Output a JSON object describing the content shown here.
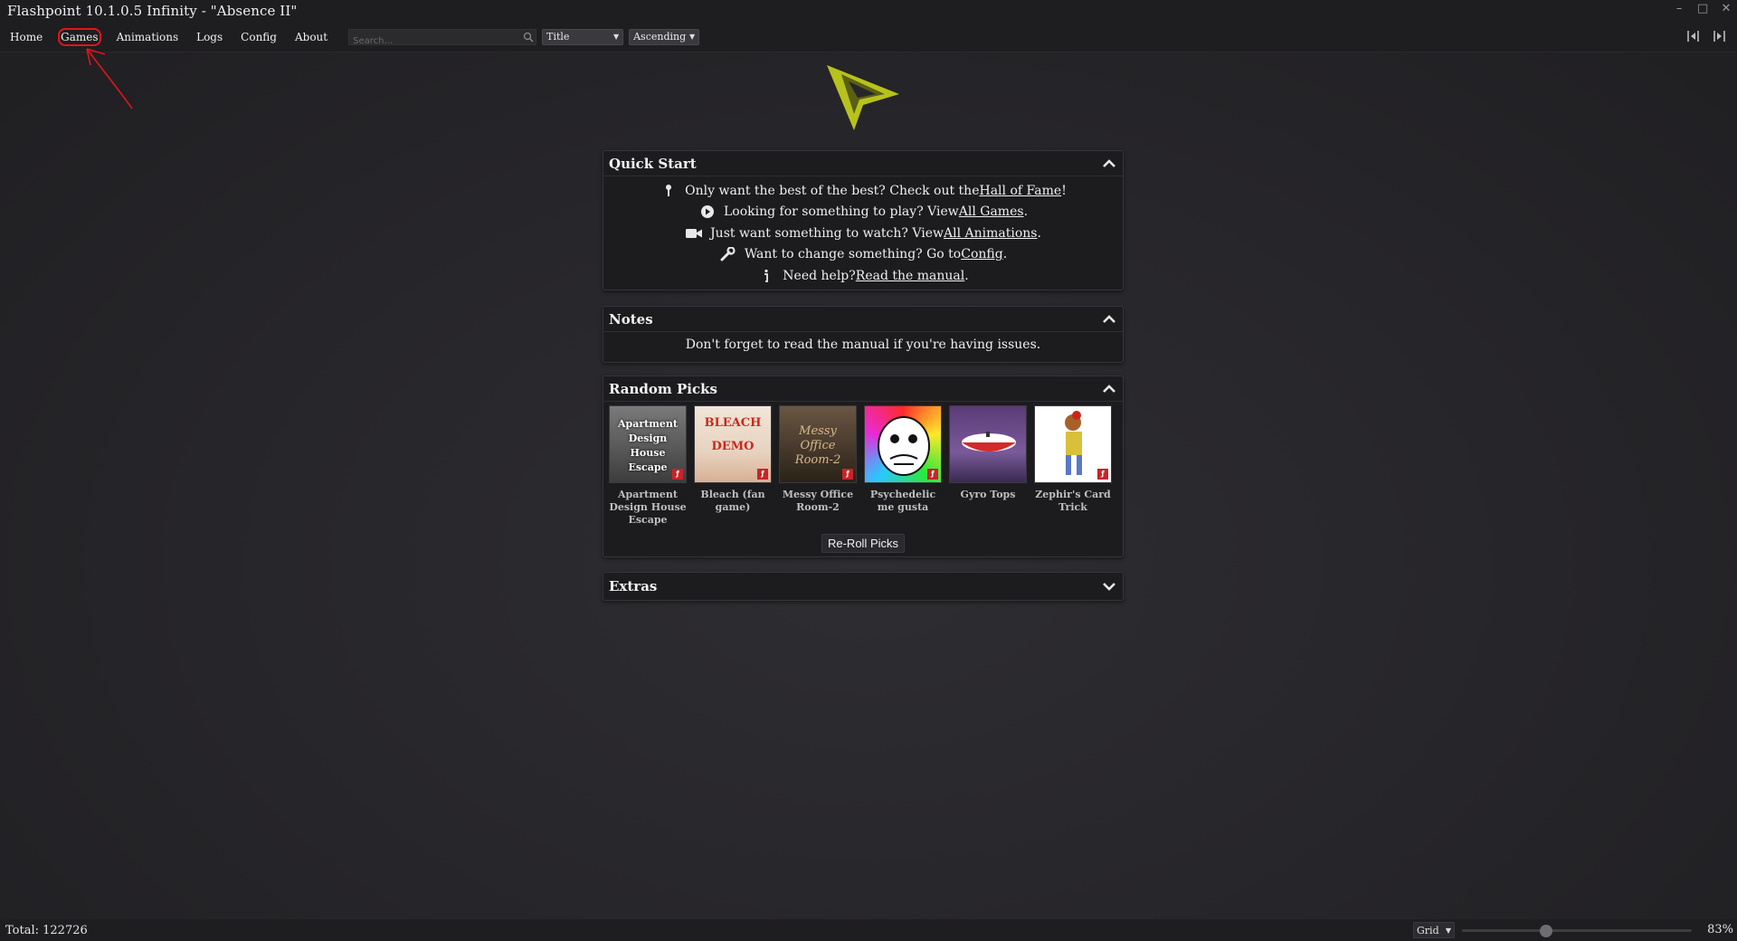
{
  "window": {
    "title": "Flashpoint 10.1.0.5 Infinity - \"Absence II\"",
    "controls": {
      "minimize": "–",
      "maximize": "□",
      "close": "✕"
    }
  },
  "nav": {
    "items": [
      {
        "label": "Home"
      },
      {
        "label": "Games"
      },
      {
        "label": "Animations"
      },
      {
        "label": "Logs"
      },
      {
        "label": "Config"
      },
      {
        "label": "About"
      }
    ]
  },
  "search": {
    "placeholder": "Search..."
  },
  "sort": {
    "field": "Title",
    "direction": "Ascending"
  },
  "quick_start": {
    "title": "Quick Start",
    "lines": [
      {
        "pre": "Only want the best of the best? Check out the ",
        "link": "Hall of Fame",
        "post": "!",
        "icon": "trophy-icon"
      },
      {
        "pre": "Looking for something to play? View ",
        "link": "All Games",
        "post": ".",
        "icon": "play-circle-icon"
      },
      {
        "pre": "Just want something to watch? View ",
        "link": "All Animations",
        "post": ".",
        "icon": "video-camera-icon"
      },
      {
        "pre": "Want to change something? Go to ",
        "link": "Config",
        "post": ".",
        "icon": "wrench-icon"
      },
      {
        "pre": "Need help? ",
        "link": "Read the manual",
        "post": ".",
        "icon": "info-icon"
      }
    ]
  },
  "notes": {
    "title": "Notes",
    "text": "Don't forget to read the manual if you're having issues."
  },
  "random_picks": {
    "title": "Random Picks",
    "picks": [
      {
        "title": "Apartment Design House Escape",
        "thumb_text": "Apartment Design House Escape",
        "thumb_colors": [
          "#7a7a7a",
          "#3d3d3d"
        ]
      },
      {
        "title": "Bleach (fan game)",
        "thumb_text": "BLEACH DEMO",
        "thumb_colors": [
          "#e8d8c8",
          "#c94a2a"
        ]
      },
      {
        "title": "Messy Office Room-2",
        "thumb_text": "Messy Office Room-2",
        "thumb_colors": [
          "#5a4a3a",
          "#2a2218"
        ]
      },
      {
        "title": "Psychedelic me gusta",
        "thumb_text": "",
        "thumb_colors": [
          "#29d84a",
          "#e83ad8"
        ]
      },
      {
        "title": "Gyro Tops",
        "thumb_text": "",
        "thumb_colors": [
          "#6a4a86",
          "#4a3a6a"
        ]
      },
      {
        "title": "Zephir's Card Trick",
        "thumb_text": "",
        "thumb_colors": [
          "#ffffff",
          "#c63a2a"
        ]
      }
    ],
    "reroll_label": "Re-Roll Picks"
  },
  "extras": {
    "title": "Extras"
  },
  "footer": {
    "total": "Total: 122726",
    "layout": "Grid",
    "zoom": "83%",
    "zoom_fraction": 0.36
  },
  "colors": {
    "accent_logo": "#b8c21c",
    "annotation": "#e2141b",
    "flash_badge": "#c8242a"
  }
}
